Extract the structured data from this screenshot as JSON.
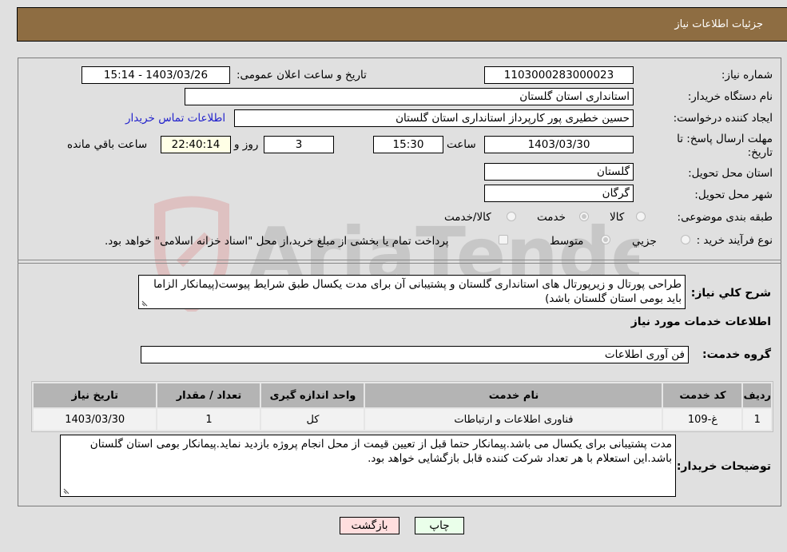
{
  "header": {
    "title": "جزئیات اطلاعات نیاز"
  },
  "fields": {
    "need_number_label": "شماره نیاز:",
    "need_number": "1103000283000023",
    "announce_label": "تاریخ و ساعت اعلان عمومی:",
    "announce_value": "1403/03/26 - 15:14",
    "buyer_org_label": "نام دستگاه خریدار:",
    "buyer_org": "استانداری استان گلستان",
    "creator_label": "ایجاد کننده درخواست:",
    "creator": "حسین خطیری پور کارپرداز استانداری استان گلستان",
    "contact_link": "اطلاعات تماس خریدار",
    "deadline_label_1": "مهلت ارسال پاسخ: تا",
    "deadline_label_2": "تاریخ:",
    "deadline_date": "1403/03/30",
    "time_label": "ساعت",
    "deadline_time": "15:30",
    "days": "3",
    "days_label": "روز و",
    "remaining": "22:40:14",
    "remaining_label": "ساعت باقي مانده",
    "province_label": "استان محل تحویل:",
    "province": "گلستان",
    "city_label": "شهر محل تحویل:",
    "city": "گرگان",
    "category_label": "طبقه بندی موضوعی:",
    "category_options": [
      "کالا",
      "خدمت",
      "کالا/خدمت"
    ],
    "category_selected": "خدمت",
    "process_label": "نوع فرآیند خرید :",
    "process_options": [
      "جزیي",
      "متوسط"
    ],
    "process_selected": "متوسط",
    "treasury_note": "پرداخت تمام یا بخشی از مبلغ خرید،از محل \"اسناد خزانه اسلامی\" خواهد بود."
  },
  "description": {
    "label": "شرح کلي نیاز:",
    "text": "طراحی پورتال و زیرپورتال های استانداری گلستان و پشتیبانی آن برای مدت یکسال طبق شرایط پیوست(پیمانکار الزاما باید بومی استان گلستان باشد)"
  },
  "services": {
    "section_title": "اطلاعات خدمات مورد نیاز",
    "group_label": "گروه خدمت:",
    "group_value": "فن آوری اطلاعات",
    "columns": [
      "ردیف",
      "کد خدمت",
      "نام خدمت",
      "واحد اندازه گیری",
      "تعداد / مقدار",
      "تاریخ نیاز"
    ],
    "rows": [
      [
        "1",
        "غ-109",
        "فناوری اطلاعات و ارتباطات",
        "کل",
        "1",
        "1403/03/30"
      ]
    ]
  },
  "buyer_notes": {
    "label": "توضیحات خریدار:",
    "text": "مدت پشتیبانی برای یکسال می باشد.پیمانکار حتما قبل از تعیین قیمت از محل انجام پروژه بازدید نماید.پیمانکار بومی استان گلستان باشد.این استعلام با هر تعداد شرکت کننده قابل بازگشایی خواهد بود."
  },
  "buttons": {
    "print": "چاپ",
    "back": "بازگشت"
  },
  "watermark": {
    "text": "AriaTender.neT"
  },
  "colors": {
    "header_bg": "#8e6d42",
    "print_bg": "#eaffea",
    "back_bg": "#ffdede",
    "remaining_bg": "#ffffe6",
    "link": "#2222cc"
  }
}
